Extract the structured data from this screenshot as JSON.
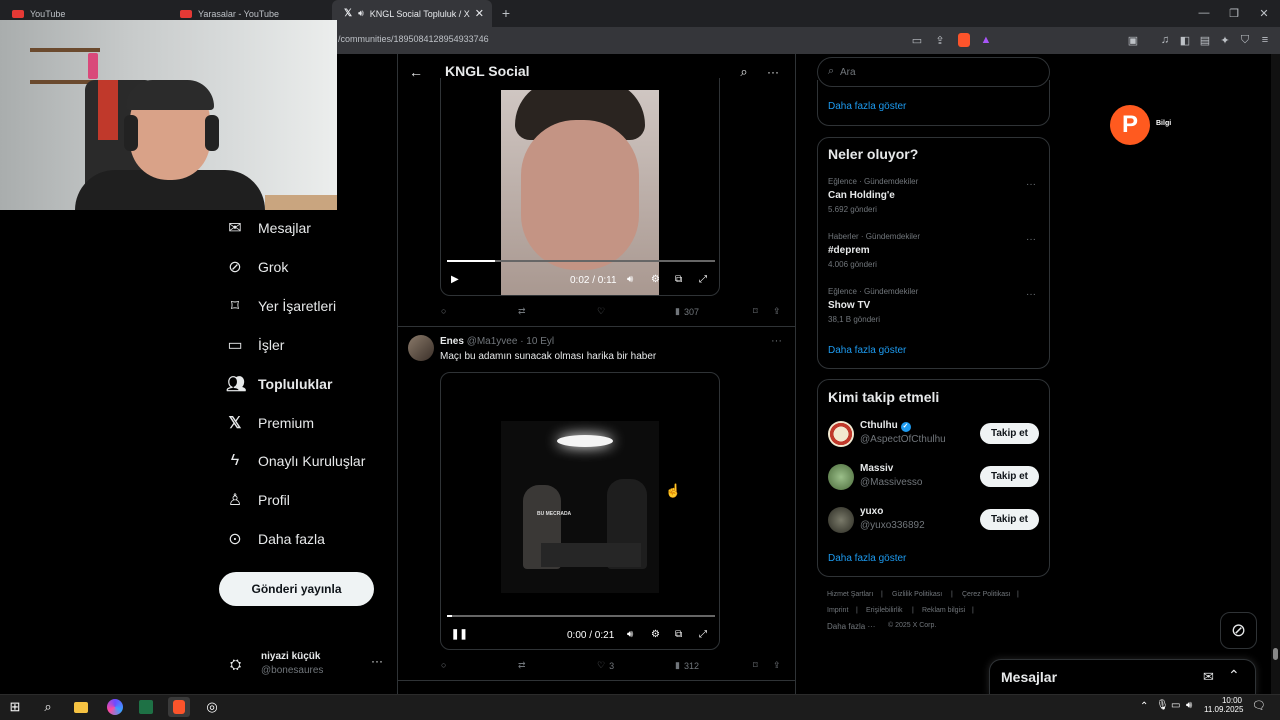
{
  "browser": {
    "tabs": [
      {
        "label": "YouTube"
      },
      {
        "label": "Yarasalar - YouTube"
      },
      {
        "label": "KNGL Social Topluluk / X"
      }
    ],
    "url": "/communities/1895084128954933746"
  },
  "nav": {
    "items": [
      {
        "label": "Mesajlar",
        "icon": "mail-icon"
      },
      {
        "label": "Grok",
        "icon": "grok-icon"
      },
      {
        "label": "Yer İşaretleri",
        "icon": "bookmark-icon"
      },
      {
        "label": "İşler",
        "icon": "briefcase-icon"
      },
      {
        "label": "Topluluklar",
        "icon": "people-icon"
      },
      {
        "label": "Premium",
        "icon": "x-logo-icon"
      },
      {
        "label": "Onaylı Kuruluşlar",
        "icon": "lightning-icon"
      },
      {
        "label": "Profil",
        "icon": "person-icon"
      },
      {
        "label": "Daha fazla",
        "icon": "more-circle-icon"
      }
    ],
    "post_button": "Gönderi yayınla",
    "user": {
      "name": "niyazi küçük",
      "handle": "@bonesaures"
    }
  },
  "header": {
    "title": "KNGL Social"
  },
  "posts": [
    {
      "video": {
        "time": "0:02 / 0:11",
        "progress": 0.18
      },
      "actions": {
        "views": "307"
      }
    },
    {
      "author": "Enes",
      "handle": "@Ma1yvee",
      "date": "· 10 Eyl",
      "text": "Maçı bu adamın sunacak olması harika bir haber",
      "video": {
        "overlay_text": "BU MECRADA",
        "time": "0:00 / 0:21",
        "progress": 0.02
      },
      "actions": {
        "likes": "3",
        "views": "312"
      }
    }
  ],
  "right": {
    "search_placeholder": "Ara",
    "show_more_top": "Daha fazla göster",
    "trends_title": "Neler oluyor?",
    "trends": [
      {
        "meta": "Eğlence · Gündemdekiler",
        "name": "Can Holding'e",
        "count": "5.692 gönderi"
      },
      {
        "meta": "Haberler · Gündemdekiler",
        "name": "#deprem",
        "count": "4.006 gönderi"
      },
      {
        "meta": "Eğlence · Gündemdekiler",
        "name": "Show TV",
        "count": "38,1 B gönderi"
      }
    ],
    "trends_more": "Daha fazla göster",
    "who_title": "Kimi takip etmeli",
    "who": [
      {
        "name": "Cthulhu",
        "handle": "@AspectOfCthulhu",
        "button": "Takip et",
        "verified": true
      },
      {
        "name": "Massiv",
        "handle": "@Massivesso",
        "button": "Takip et",
        "verified": false
      },
      {
        "name": "yuxo",
        "handle": "@yuxo336892",
        "button": "Takip et",
        "verified": false
      }
    ],
    "who_more": "Daha fazla göster",
    "footer": [
      "Hizmet Şartları",
      "Gizlilik Politikası",
      "Çerez Politikası",
      "Imprint",
      "Erişilebilirlik",
      "Reklam bilgisi",
      "Daha fazla ···",
      "© 2025 X Corp."
    ]
  },
  "overlay": {
    "badge_text": "Bilgi"
  },
  "messages_panel": {
    "title": "Mesajlar"
  },
  "taskbar": {
    "time": "10:00",
    "date": "11.09.2025"
  },
  "colors": {
    "accent": "#1d9bf0",
    "bg": "#000000",
    "border": "#2f3336",
    "muted": "#71767b"
  }
}
